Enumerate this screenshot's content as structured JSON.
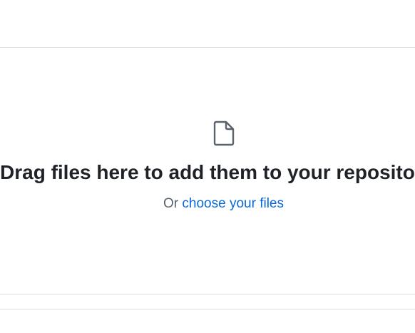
{
  "dropzone": {
    "icon": "file-icon",
    "title": "Drag files here to add them to your repository",
    "or_text": "Or",
    "choose_link": "choose your files"
  },
  "colors": {
    "text": "#1f2328",
    "muted": "#59636e",
    "link": "#0969da",
    "border": "#d8dee4",
    "icon": "#59636e"
  }
}
